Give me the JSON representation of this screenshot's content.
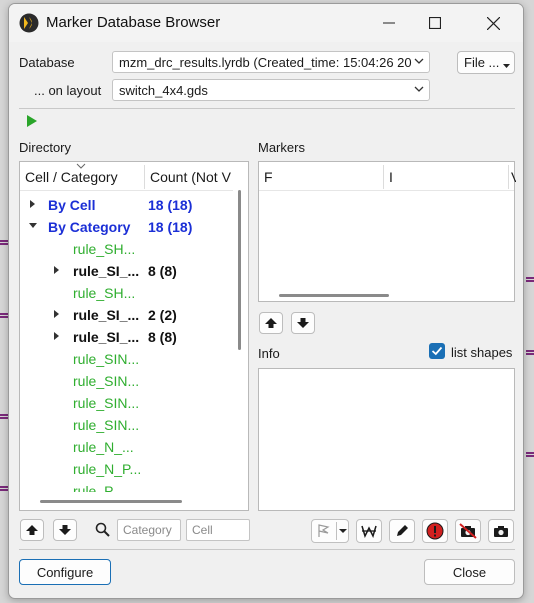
{
  "window": {
    "title": "Marker Database Browser",
    "minimize_icon": "minimize-icon",
    "maximize_icon": "maximize-icon",
    "close_icon": "close-icon"
  },
  "database": {
    "label": "Database",
    "value": "mzm_drc_results.lyrdb (Created_time: 15:04:26 20",
    "file_button": "File ..."
  },
  "layout": {
    "label": "... on layout",
    "value": "switch_4x4.gds"
  },
  "run_icon": "play-icon",
  "directory": {
    "title": "Directory",
    "columns": [
      "Cell / Category",
      "Count (Not V"
    ],
    "rows": [
      {
        "name": "By Cell",
        "count": "18 (18)",
        "style": "blue",
        "level": 0,
        "arrow": "right"
      },
      {
        "name": "By Category",
        "count": "18 (18)",
        "style": "blue",
        "level": 0,
        "arrow": "down"
      },
      {
        "name": "rule_SH...",
        "count": "",
        "style": "green",
        "level": 1,
        "arrow": ""
      },
      {
        "name": "rule_SI_...",
        "count": "8 (8)",
        "style": "bold",
        "level": 1,
        "arrow": "right"
      },
      {
        "name": "rule_SH...",
        "count": "",
        "style": "green",
        "level": 1,
        "arrow": ""
      },
      {
        "name": "rule_SI_...",
        "count": "2 (2)",
        "style": "bold",
        "level": 1,
        "arrow": "right"
      },
      {
        "name": "rule_SI_...",
        "count": "8 (8)",
        "style": "bold",
        "level": 1,
        "arrow": "right"
      },
      {
        "name": "rule_SIN...",
        "count": "",
        "style": "green",
        "level": 1,
        "arrow": ""
      },
      {
        "name": "rule_SIN...",
        "count": "",
        "style": "green",
        "level": 1,
        "arrow": ""
      },
      {
        "name": "rule_SIN...",
        "count": "",
        "style": "green",
        "level": 1,
        "arrow": ""
      },
      {
        "name": "rule_SIN...",
        "count": "",
        "style": "green",
        "level": 1,
        "arrow": ""
      },
      {
        "name": "rule_N_...",
        "count": "",
        "style": "green",
        "level": 1,
        "arrow": ""
      },
      {
        "name": "rule_N_P...",
        "count": "",
        "style": "green",
        "level": 1,
        "arrow": ""
      },
      {
        "name": "rule_P...",
        "count": "",
        "style": "green",
        "level": 1,
        "arrow": ""
      }
    ],
    "category_placeholder": "Category",
    "cell_placeholder": "Cell"
  },
  "markers": {
    "title": "Markers",
    "columns": [
      "F",
      "I",
      "V"
    ]
  },
  "info": {
    "title": "Info",
    "list_shapes_label": "list shapes",
    "list_shapes_checked": true
  },
  "footer": {
    "configure": "Configure",
    "close": "Close"
  },
  "colors": {
    "blue": "#1b2fd6",
    "green": "#2fae2f",
    "accent": "#1a6fb5",
    "error_red": "#d12020"
  }
}
